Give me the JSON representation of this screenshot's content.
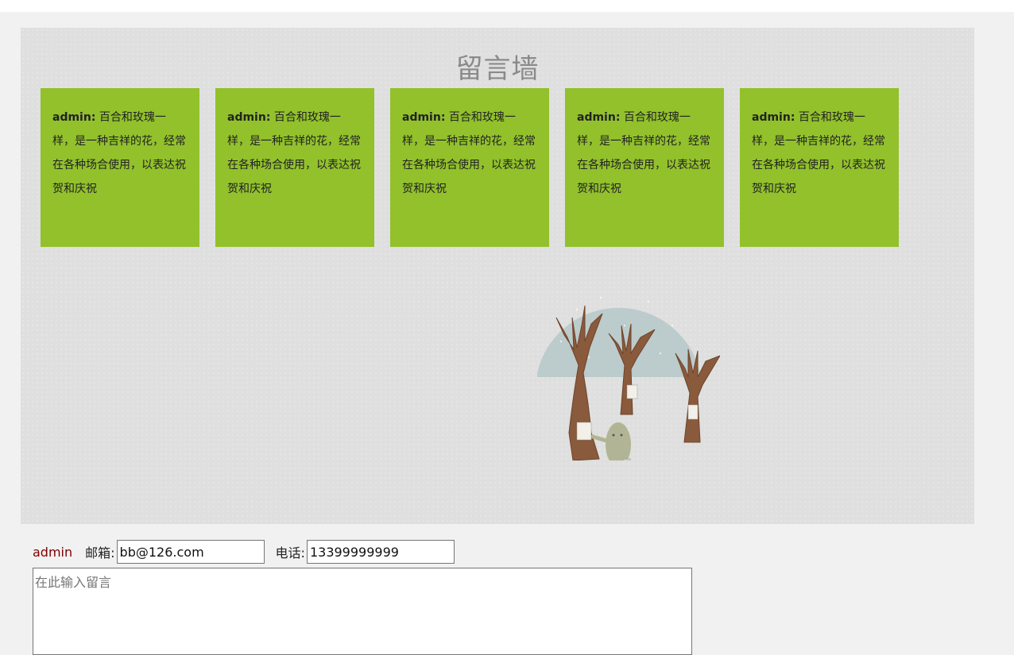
{
  "wall": {
    "title": "留言墙",
    "notes": [
      {
        "author": "admin:",
        "text": "百合和玫瑰一样，是一种吉祥的花，经常在各种场合使用，以表达祝贺和庆祝"
      },
      {
        "author": "admin:",
        "text": "百合和玫瑰一样，是一种吉祥的花，经常在各种场合使用，以表达祝贺和庆祝"
      },
      {
        "author": "admin:",
        "text": "百合和玫瑰一样，是一种吉祥的花，经常在各种场合使用，以表达祝贺和庆祝"
      },
      {
        "author": "admin:",
        "text": "百合和玫瑰一样，是一种吉祥的花，经常在各种场合使用，以表达祝贺和庆祝"
      },
      {
        "author": "admin:",
        "text": "百合和玫瑰一样，是一种吉祥的花，经常在各种场合使用，以表达祝贺和庆祝"
      }
    ],
    "note_color": "#92c12c"
  },
  "form": {
    "username": "admin",
    "email_label": "邮箱:",
    "email_value": "bb@126.com",
    "phone_label": "电话:",
    "phone_value": "13399999999",
    "message_placeholder": "在此输入留言"
  }
}
